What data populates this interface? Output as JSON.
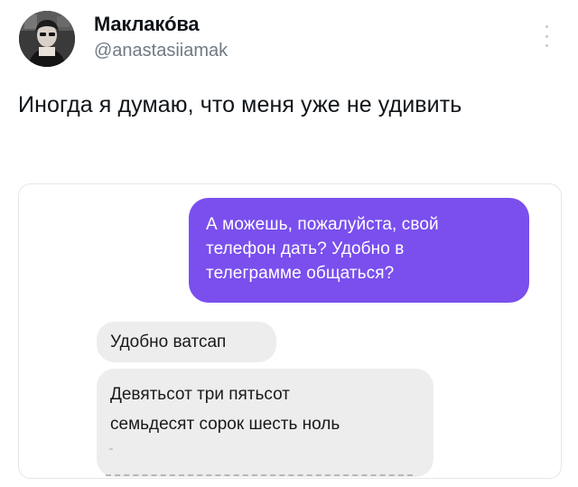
{
  "author": {
    "display_name": "Маклакóва",
    "handle": "@anastasiiamak"
  },
  "icons": {
    "avatar": "user-avatar-photo",
    "more": "more-options-icon"
  },
  "tweet": {
    "text": "Иногда я думаю, что меня уже не удивить"
  },
  "chat": {
    "outgoing": {
      "lines": [
        "А можешь, пожалуйста, свой",
        "телефон дать? Удобно в",
        "телеграмме общаться?"
      ],
      "color": "#7a4fee"
    },
    "incoming": [
      {
        "lines": [
          "Удобно ватсап"
        ]
      },
      {
        "lines": [
          "Девятьсот три пятьсот",
          "семьдесят сорок шесть ноль"
        ]
      }
    ],
    "incoming_color": "#ededed"
  }
}
